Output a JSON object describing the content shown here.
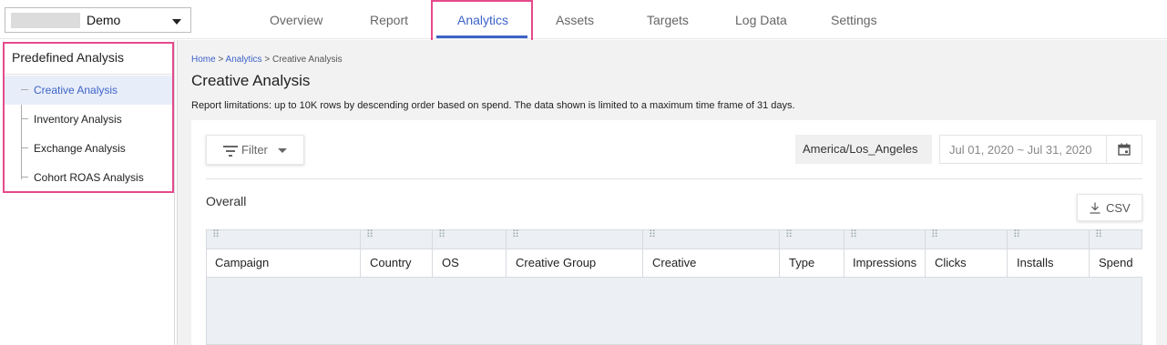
{
  "account": {
    "name": "Demo"
  },
  "nav": {
    "tabs": [
      {
        "label": "Overview"
      },
      {
        "label": "Report"
      },
      {
        "label": "Analytics"
      },
      {
        "label": "Assets"
      },
      {
        "label": "Targets"
      },
      {
        "label": "Log Data"
      },
      {
        "label": "Settings"
      }
    ],
    "active": "Analytics"
  },
  "sidebar": {
    "heading": "Predefined Analysis",
    "items": [
      {
        "label": "Creative Analysis"
      },
      {
        "label": "Inventory Analysis"
      },
      {
        "label": "Exchange Analysis"
      },
      {
        "label": "Cohort ROAS Analysis"
      }
    ],
    "active": "Creative Analysis"
  },
  "breadcrumb": {
    "home": "Home",
    "sep1": ">",
    "analytics": "Analytics",
    "sep2": ">",
    "current": "Creative Analysis"
  },
  "page": {
    "title": "Creative Analysis",
    "limit_note": "Report limitations: up to 10K rows by descending order based on spend. The data shown is limited to a maximum time frame of 31 days."
  },
  "toolbar": {
    "filter_label": "Filter",
    "timezone": "America/Los_Angeles",
    "date_range": "Jul 01, 2020 ~ Jul 31, 2020"
  },
  "section": {
    "title": "Overall",
    "csv_label": "CSV"
  },
  "table": {
    "columns": [
      {
        "label": "Campaign"
      },
      {
        "label": "Country"
      },
      {
        "label": "OS"
      },
      {
        "label": "Creative Group"
      },
      {
        "label": "Creative"
      },
      {
        "label": "Type"
      },
      {
        "label": "Impressions"
      },
      {
        "label": "Clicks"
      },
      {
        "label": "Installs"
      },
      {
        "label": "Spend"
      }
    ]
  },
  "colors": {
    "accent": "#3d63c9",
    "highlight": "#e64a8c",
    "background": "#f2f2f2"
  }
}
